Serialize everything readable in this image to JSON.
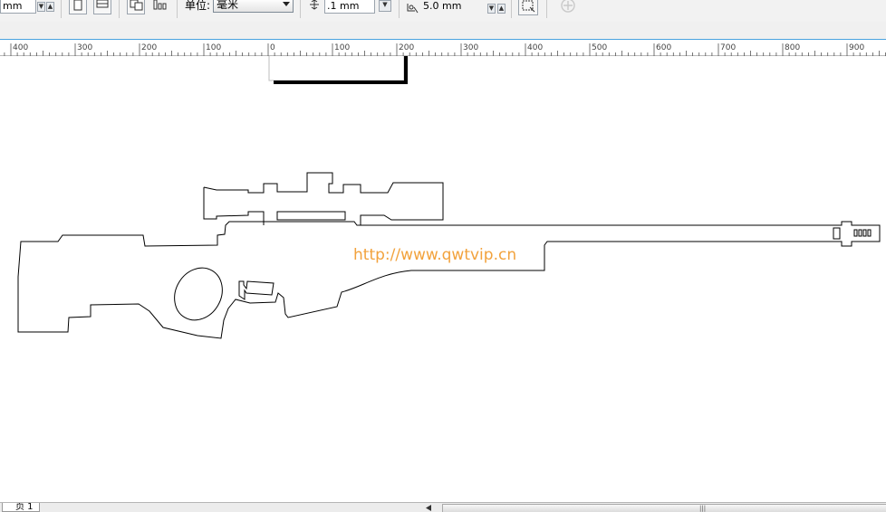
{
  "toolbar": {
    "left_unit_value": "mm",
    "unit_label": "单位:",
    "unit_select_value": "毫米",
    "nudge_value": ".1 mm",
    "duplicate_distance_value": "5.0 mm"
  },
  "ruler": {
    "labels": [
      "400",
      "300",
      "200",
      "100",
      "0",
      "100",
      "200",
      "300",
      "400",
      "500",
      "600",
      "700",
      "800",
      "900"
    ]
  },
  "canvas": {
    "watermark_text": "http://www.qwtvip.cn"
  },
  "status": {
    "page_tab_label": "页 1"
  },
  "colors": {
    "watermark": "#f2a23c",
    "ruler_top_border": "#4aa3df"
  }
}
